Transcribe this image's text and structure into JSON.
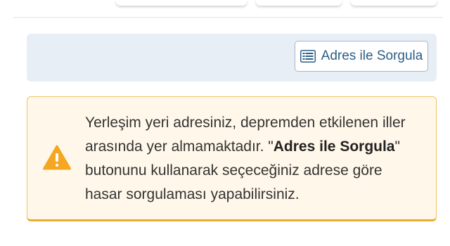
{
  "query_panel": {
    "button_label": "Adres ile Sorgula",
    "button_icon": "list-icon"
  },
  "alert": {
    "icon": "warning-icon",
    "colors": {
      "background": "#fff8ea",
      "border": "#e9ac2e",
      "icon": "#f5a623"
    },
    "text_part1": "Yerleşim yeri adresiniz, depremden etkilenen iller arasında yer almamaktadır. \"",
    "text_bold1": "Adres ile",
    "text_space": " ",
    "text_bold2": "Sorgula",
    "text_part2": "\" butonunu kullanarak seçeceğiniz adrese göre hasar sorgulaması yapabilirsiniz."
  }
}
